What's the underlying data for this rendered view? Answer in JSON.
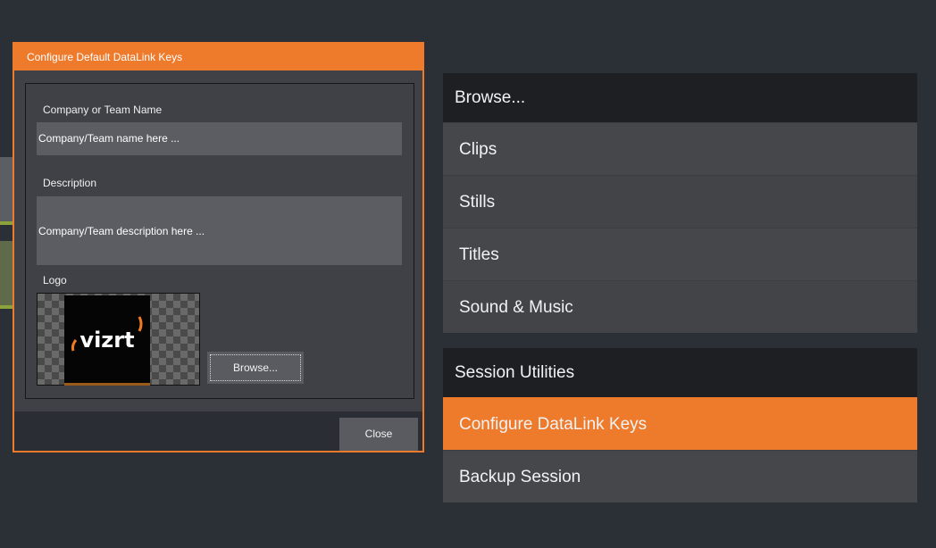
{
  "dialog": {
    "title": "Configure Default DataLink Keys",
    "company_label": "Company or Team Name",
    "company_value": "Company/Team name here ...",
    "description_label": "Description",
    "description_value": "Company/Team description here ...",
    "logo_label": "Logo",
    "logo_text": "vizrt",
    "browse_label": "Browse...",
    "close_label": "Close"
  },
  "browse_menu": {
    "header": "Browse...",
    "items": [
      {
        "label": "Clips"
      },
      {
        "label": "Stills"
      },
      {
        "label": "Titles"
      },
      {
        "label": "Sound & Music"
      }
    ]
  },
  "session_menu": {
    "header": "Session Utilities",
    "items": [
      {
        "label": "Configure DataLink Keys",
        "active": true
      },
      {
        "label": "Backup Session",
        "active": false
      }
    ]
  },
  "colors": {
    "accent": "#ee7a2b",
    "background": "#2b2f36",
    "panel": "#3f4147"
  }
}
